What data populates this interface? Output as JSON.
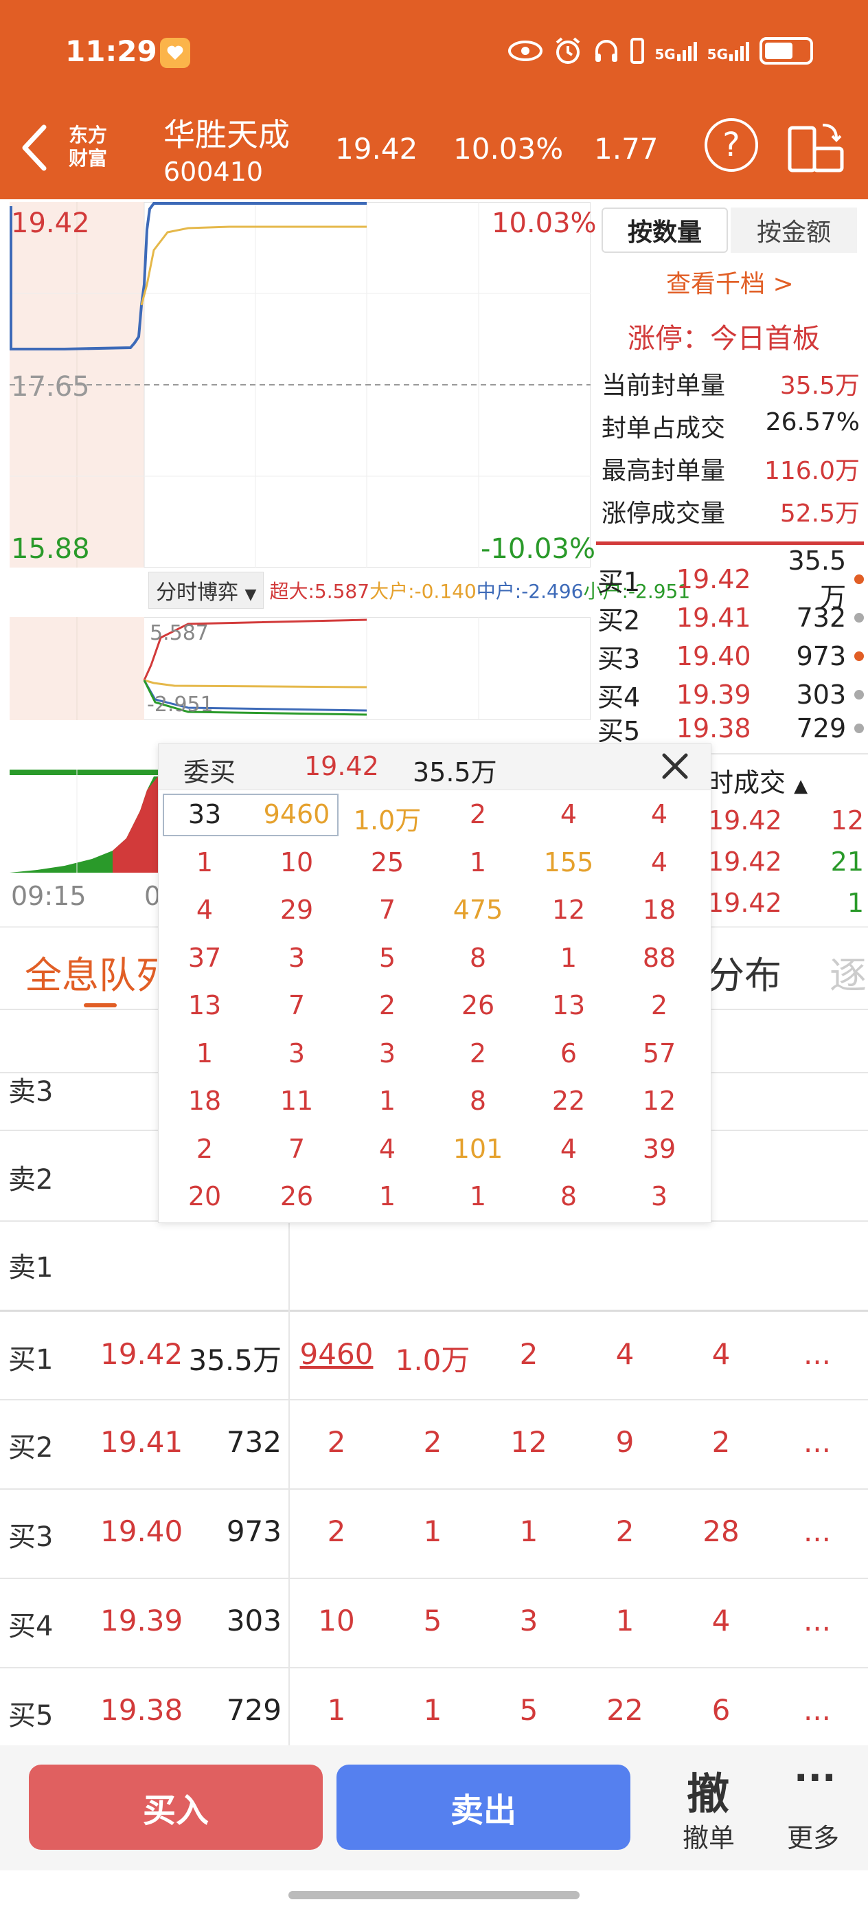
{
  "status": {
    "time": "11:29",
    "network1": "5G",
    "network2": "5G"
  },
  "header": {
    "broker_line1": "东方",
    "broker_line2": "财富",
    "stock_name": "华胜天成",
    "stock_code": "600410",
    "price": "19.42",
    "change_pct": "10.03%",
    "amount": "1.77",
    "help_glyph": "?"
  },
  "chart": {
    "price_max": "19.42",
    "price_mid": "17.65",
    "price_min": "15.88",
    "pct_max": "10.03%",
    "pct_min": "-10.03%",
    "game_dropdown": "分时博弈",
    "game_big": "超大:5.587",
    "game_large": "大户:-0.140",
    "game_mid": "中户:-2.496",
    "game_small": "小户:-2.951",
    "mini_max": "5.587",
    "mini_min": "-2.951",
    "time_start": "09:15",
    "time_mid": "0",
    "colors": {
      "price_line": "#3d6ab8",
      "avg_line": "#e5b84a",
      "up": "#d23a3a",
      "down": "#2a9a2a"
    }
  },
  "right_panel": {
    "tab_qty": "按数量",
    "tab_amount": "按金额",
    "view_levels": "查看千档 >",
    "limit_title": "涨停：今日首板",
    "limit_rows": [
      {
        "label": "当前封单量",
        "value": "35.5万"
      },
      {
        "label": "封单占成交",
        "value": "26.57%"
      },
      {
        "label": "最高封单量",
        "value": "116.0万"
      },
      {
        "label": "涨停成交量",
        "value": "52.5万"
      }
    ],
    "orderbook": [
      {
        "label": "买1",
        "price": "19.42",
        "vol": "35.5万",
        "dot": "#e15e25"
      },
      {
        "label": "买2",
        "price": "19.41",
        "vol": "732",
        "dot": "#aaaaaa"
      },
      {
        "label": "买3",
        "price": "19.40",
        "vol": "973",
        "dot": "#e15e25"
      },
      {
        "label": "买4",
        "price": "19.39",
        "vol": "303",
        "dot": "#aaaaaa"
      },
      {
        "label": "买5",
        "price": "19.38",
        "vol": "729",
        "dot": "#aaaaaa"
      }
    ],
    "ticks_title": "时成交",
    "ticks": [
      {
        "price": "19.42",
        "vol": "12",
        "color": "#d23a3a"
      },
      {
        "price": "19.42",
        "vol": "21",
        "color": "#2a9a2a"
      },
      {
        "price": "19.42",
        "vol": "1",
        "color": "#2a9a2a"
      }
    ]
  },
  "tabs": {
    "queue": "全息队列",
    "distribution": "分布",
    "each": "逐"
  },
  "queue": {
    "sell_labels": [
      "卖3",
      "卖2",
      "卖1"
    ],
    "rows": [
      {
        "label": "买1",
        "price": "19.42",
        "vol": "35.5万",
        "cells": [
          "9460",
          "1.0万",
          "2",
          "4",
          "4",
          "..."
        ]
      },
      {
        "label": "买2",
        "price": "19.41",
        "vol": "732",
        "cells": [
          "2",
          "2",
          "12",
          "9",
          "2",
          "..."
        ]
      },
      {
        "label": "买3",
        "price": "19.40",
        "vol": "973",
        "cells": [
          "2",
          "1",
          "1",
          "2",
          "28",
          "..."
        ]
      },
      {
        "label": "买4",
        "price": "19.39",
        "vol": "303",
        "cells": [
          "10",
          "5",
          "3",
          "1",
          "4",
          "..."
        ]
      },
      {
        "label": "买5",
        "price": "19.38",
        "vol": "729",
        "cells": [
          "1",
          "1",
          "5",
          "22",
          "6",
          "..."
        ]
      }
    ]
  },
  "popup": {
    "title": "委买",
    "price": "19.42",
    "vol": "35.5万",
    "rows": [
      [
        "33",
        "9460",
        "1.0万",
        "2",
        "4",
        "4"
      ],
      [
        "1",
        "10",
        "25",
        "1",
        "155",
        "4"
      ],
      [
        "4",
        "29",
        "7",
        "475",
        "12",
        "18"
      ],
      [
        "37",
        "3",
        "5",
        "8",
        "1",
        "88"
      ],
      [
        "13",
        "7",
        "2",
        "26",
        "13",
        "2"
      ],
      [
        "1",
        "3",
        "3",
        "2",
        "6",
        "57"
      ],
      [
        "18",
        "11",
        "1",
        "8",
        "22",
        "12"
      ],
      [
        "2",
        "7",
        "4",
        "101",
        "4",
        "39"
      ],
      [
        "20",
        "26",
        "1",
        "1",
        "8",
        "3"
      ]
    ]
  },
  "bottom": {
    "buy": "买入",
    "sell": "卖出",
    "cancel_glyph": "撤",
    "cancel": "撤单",
    "more_glyph": "···",
    "more": "更多"
  }
}
